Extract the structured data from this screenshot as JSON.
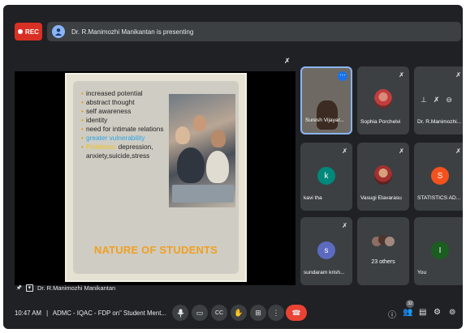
{
  "recording": {
    "label": "REC"
  },
  "banner": {
    "text": "Dr. R.Manimozhi Manikantan is presenting"
  },
  "slide": {
    "bullets": [
      "increased potential",
      "abstract thought",
      "self awareness",
      "identity",
      "need for intimate relations"
    ],
    "highlight_bullet": "greater vulnerability",
    "last_bullet_prefix": "Problems:",
    "last_bullet_rest": " depression, anxiety,suicide,stress",
    "title": "NATURE OF STUDENTS"
  },
  "presenter_label": "Dr. R.Manimozhi Manikantan",
  "participants": {
    "p1": {
      "name": "Suresh Vijayar..."
    },
    "p2": {
      "name": "Sophia Porchelvi"
    },
    "p3": {
      "name": "Dr. R.Manimozhi..."
    },
    "p4": {
      "name": "kavi tha",
      "initial": "k"
    },
    "p5": {
      "name": "Vasugi Elavarasu"
    },
    "p6": {
      "name": "STATISTICS AD...",
      "initial": "S"
    },
    "p7": {
      "name": "sundaram krish...",
      "initial": "s"
    },
    "p8": {
      "label": "23 others"
    },
    "p9": {
      "name": "You",
      "initial": "I"
    }
  },
  "colors": {
    "rec": "#d93025",
    "end_call": "#ea4335",
    "k_avatar": "#00897b",
    "s_avatar": "#f4511e",
    "sundaram_avatar": "#5c6bc0",
    "you_avatar": "#1b5e20"
  },
  "bottom": {
    "time": "10:47 AM",
    "separator": "|",
    "meeting_name": "ADMC - IQAC - FDP on\" Student Ment...",
    "participants_badge": "32"
  },
  "icons": {
    "mic": "mic-icon",
    "camera": "camera-off-icon",
    "captions": "captions-icon",
    "raise_hand": "raise-hand-icon",
    "present": "present-icon",
    "more": "more-icon",
    "end": "end-call-icon",
    "info": "info-icon",
    "people": "people-icon",
    "chat": "chat-icon",
    "activities": "activities-icon",
    "host": "host-controls-icon"
  }
}
